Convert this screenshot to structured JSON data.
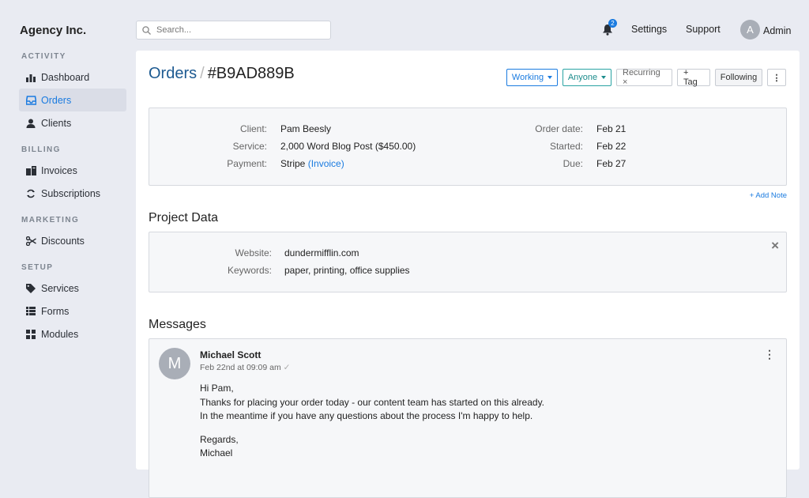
{
  "brand": "Agency Inc.",
  "sidebar": {
    "sections": [
      {
        "title": "ACTIVITY",
        "items": [
          {
            "label": "Dashboard",
            "icon": "bar-chart-icon",
            "active": false
          },
          {
            "label": "Orders",
            "icon": "inbox-icon",
            "active": true
          },
          {
            "label": "Clients",
            "icon": "user-icon",
            "active": false
          }
        ]
      },
      {
        "title": "BILLING",
        "items": [
          {
            "label": "Invoices",
            "icon": "invoices-icon",
            "active": false
          },
          {
            "label": "Subscriptions",
            "icon": "refresh-icon",
            "active": false
          }
        ]
      },
      {
        "title": "MARKETING",
        "items": [
          {
            "label": "Discounts",
            "icon": "scissors-icon",
            "active": false
          }
        ]
      },
      {
        "title": "SETUP",
        "items": [
          {
            "label": "Services",
            "icon": "tag-icon",
            "active": false
          },
          {
            "label": "Forms",
            "icon": "list-icon",
            "active": false
          },
          {
            "label": "Modules",
            "icon": "grid-icon",
            "active": false
          }
        ]
      }
    ]
  },
  "topbar": {
    "search_placeholder": "Search...",
    "notification_count": "2",
    "settings": "Settings",
    "support": "Support",
    "user_initial": "A",
    "user_name": "Admin"
  },
  "order": {
    "breadcrumb": "Orders",
    "separator": "/",
    "id": "#B9AD889B",
    "buttons": {
      "status": "Working",
      "assignee": "Anyone",
      "recurring": "Recurring ×",
      "tag": "+ Tag",
      "following": "Following",
      "more": "⋮"
    },
    "details": {
      "client_label": "Client:",
      "client": "Pam Beesly",
      "service_label": "Service:",
      "service": "2,000 Word Blog Post ($450.00)",
      "payment_label": "Payment:",
      "payment": "Stripe",
      "payment_link": "(Invoice)",
      "order_date_label": "Order date:",
      "order_date": "Feb 21",
      "started_label": "Started:",
      "started": "Feb 22",
      "due_label": "Due:",
      "due": "Feb 27"
    },
    "add_note": "+ Add Note"
  },
  "project_data": {
    "title": "Project Data",
    "website_label": "Website:",
    "website": "dundermifflin.com",
    "keywords_label": "Keywords:",
    "keywords": "paper, printing, office supplies",
    "close": "×"
  },
  "messages": {
    "title": "Messages",
    "items": [
      {
        "initial": "M",
        "author": "Michael Scott",
        "time": "Feb 22nd at 09:09 am",
        "check": "✓",
        "menu": "⋮",
        "lines": [
          "Hi Pam,",
          "Thanks for placing your order today - our content team has started on this already.",
          "In the meantime if you have any questions about the process I'm happy to help.",
          "",
          "Regards,",
          "Michael"
        ]
      }
    ]
  },
  "colors": {
    "accent": "#1a7be0",
    "teal": "#29a3a3",
    "background": "#e9ebf2"
  }
}
